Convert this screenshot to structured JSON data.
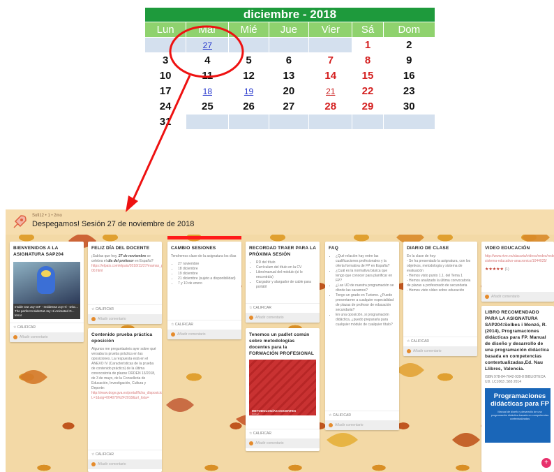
{
  "calendar": {
    "title": "diciembre - 2018",
    "weekdays": [
      "Lun",
      "Mar",
      "Mié",
      "Jue",
      "Vier",
      "Sá",
      "Dom"
    ],
    "weeks": [
      [
        "",
        "27",
        "",
        "",
        "",
        "1",
        "2"
      ],
      [
        "3",
        "4",
        "5",
        "6",
        "7",
        "8",
        "9"
      ],
      [
        "10",
        "11",
        "12",
        "13",
        "14",
        "15",
        "16"
      ],
      [
        "17",
        "18",
        "19",
        "20",
        "21",
        "22",
        "23"
      ],
      [
        "24",
        "25",
        "26",
        "27",
        "28",
        "29",
        "30"
      ],
      [
        "31",
        "",
        "",
        "",
        "",
        "",
        ""
      ]
    ],
    "colors": {
      "title_bg": "#1e9a3c",
      "weekday_bg": "#8fd26e",
      "empty_bg": "#d4e0ee",
      "weekend": "#d42020",
      "link": "#2233cc"
    }
  },
  "annotation": {
    "color": "#ee1111"
  },
  "board": {
    "meta": "Sofi12 • 1 • 2mo",
    "title": "Despegamos! Sesión 27 de noviembre de 2018",
    "rate_label": "CALIFICAR",
    "comment_label": "Añadir comentario",
    "cards": {
      "bienvenidos": {
        "title": "BIENVENIDOS A LA ASIGNATURA SAP204",
        "caption": "Inside Out Joy GIF - InsideOut Joy Hi - Disc... The perfect InsideOut Joy Hi Animated G...",
        "caption_src": "tenor"
      },
      "docente": {
        "title": "FELIZ DÍA DEL DOCENTE",
        "body_a": "¡Sabías que hoy, ",
        "body_em": "27 de noviembre",
        "body_b": " se celebra el ",
        "body_em2": "día del profesor",
        "body_c": " en España?",
        "link": "https://elpais.com/elpais/2018/11/27/mamas_papas/1543335994_2323 00.html"
      },
      "cambio": {
        "title": "CAMBIO SESIONES",
        "intro": "Tendremos clase de la asignatura los días",
        "items": [
          "27 noviembre",
          "18 diciembre",
          "19 diciembre",
          "21 diciembre (sujeto a disponibilidad)",
          "7 y 10 de enero"
        ]
      },
      "recordad": {
        "title": "RECORDAD TRAER PARA LA PRÓXIMA SESIÓN",
        "items": [
          "RD del título",
          "Currículum del título en la CV",
          "Libro/manual del módulo (si lo encontráis)",
          "Cargador y alargador de cable para portátil"
        ]
      },
      "faq": {
        "title": "FAQ",
        "items": [
          "¿Qué relación hay entre las cualificaciones profesionales y la oferta formativa de FP en España?",
          "¿Cuál es la normativa básica que tengo que conocer para planificar en FP?",
          "¿Las UD de nuestra programación se dónde las sacamos?",
          "Tengo un grado en Turismo. ¿Puedo presentarme a cualquier especialidad de plazas de profesor de educación secundaria?",
          "En una oposición, si programación didáctica, ¿puedo prepararla para cualquier módulo de cualquier título?"
        ]
      },
      "diario": {
        "title": "DIARIO DE CLASE",
        "lines": [
          "En la clase de hoy:",
          "- Se ha presentado la asignatura, con los objetivos, metodología y sistema de evaluación",
          "- Hemos visto punto 1.1. del Tema 1",
          "- Hemos analizado la última convocatoria de plazas a profesorado de secundaria",
          "- Hemos visto vídeo sobre educación"
        ]
      },
      "video": {
        "title": "VIDEO EDUCACIÓN",
        "link": "http://www.rtve.es/alacarta/videos/redes/redes-sistema-educativo-anacronico/1044025/",
        "stars": "★★★★★",
        "star_count": "(1)"
      },
      "contenido": {
        "title": "Contenido prueba práctica oposición",
        "body": "Algunos me preguntasteis ayer sobre qué versaba la prueba práctica en las oposiciones. La respuesta está en el ANEXO IV (Características de la prueba de contenido práctico) de la última convocatoria de plazas ORDEN 13/2018, de 3 de mayo, de la Conselleria de Educación, Investigación, Cultura y Deporte:",
        "link": "http://www.dogv.gva.es/portal/ficha_disposicion.jsp?L=1&sig=004078%2F2018&url_lista="
      },
      "padlet": {
        "title": "Tenemos un padlet común sobre metodologías docentes para la FORMACIÓN PROFESIONAL",
        "thumb_caption": "METODOLOGÍAS DOCENTES",
        "thumb_sub": "Sofi12"
      },
      "libro": {
        "title": "LIBRO RECOMENDADO PARA LA ASIGNATURA SAP204:Solbes i Monzó, R. (2014), Programaciones didácticas para FP. Manual de diseño y desarrollo de una programación didáctica basada en competencias contextualizadas,Ed. Nau Llibres, Valencia.",
        "isbn": "ISBN 978-84-7642-939-8 BIBLIOTECA UJI. LC1063 .S65 2014",
        "book_title": "Programaciones didácticas para FP",
        "book_sub": "Manual de diseño y desarrollo de una programación didáctica basada en competencias contextualizadas"
      }
    },
    "colors": {
      "header_bg": "#f6ddae",
      "board_bg": "#f3d9a6",
      "accent": "#e8306c",
      "tab_red": "#ff1a1a"
    }
  }
}
